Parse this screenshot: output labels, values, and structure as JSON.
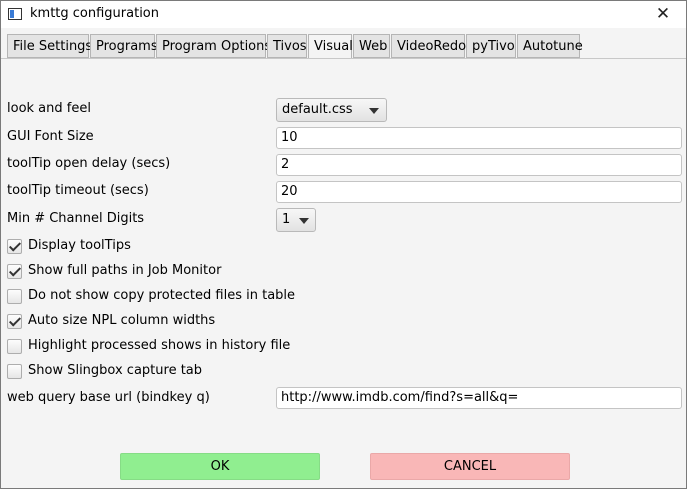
{
  "window": {
    "title": "kmttg configuration",
    "close_glyph": "✕"
  },
  "tabs": [
    {
      "label": "File Settings"
    },
    {
      "label": "Programs"
    },
    {
      "label": "Program Options"
    },
    {
      "label": "Tivos"
    },
    {
      "label": "Visual"
    },
    {
      "label": "Web"
    },
    {
      "label": "VideoRedo"
    },
    {
      "label": "pyTivo"
    },
    {
      "label": "Autotune"
    }
  ],
  "active_tab": "Visual",
  "settings": {
    "look_and_feel": {
      "label": "look and feel",
      "value": "default.css"
    },
    "gui_font_size": {
      "label": "GUI Font Size",
      "value": "10"
    },
    "tooltip_open_delay": {
      "label": "toolTip open delay (secs)",
      "value": "2"
    },
    "tooltip_timeout": {
      "label": "toolTip timeout (secs)",
      "value": "20"
    },
    "min_channel_digits": {
      "label": "Min # Channel Digits",
      "value": "1"
    },
    "web_query_base_url": {
      "label": "web query base url (bindkey q)",
      "value": "http://www.imdb.com/find?s=all&q="
    }
  },
  "checkboxes": [
    {
      "label": "Display toolTips",
      "checked": true
    },
    {
      "label": "Show full paths in Job Monitor",
      "checked": true
    },
    {
      "label": "Do not show copy protected files in table",
      "checked": false
    },
    {
      "label": "Auto size NPL column widths",
      "checked": true
    },
    {
      "label": "Highlight processed shows in history file",
      "checked": false
    },
    {
      "label": "Show Slingbox capture tab",
      "checked": false
    }
  ],
  "buttons": {
    "ok": "OK",
    "cancel": "CANCEL"
  },
  "colors": {
    "ok": "#90ee90",
    "cancel": "#f9b7b7"
  }
}
